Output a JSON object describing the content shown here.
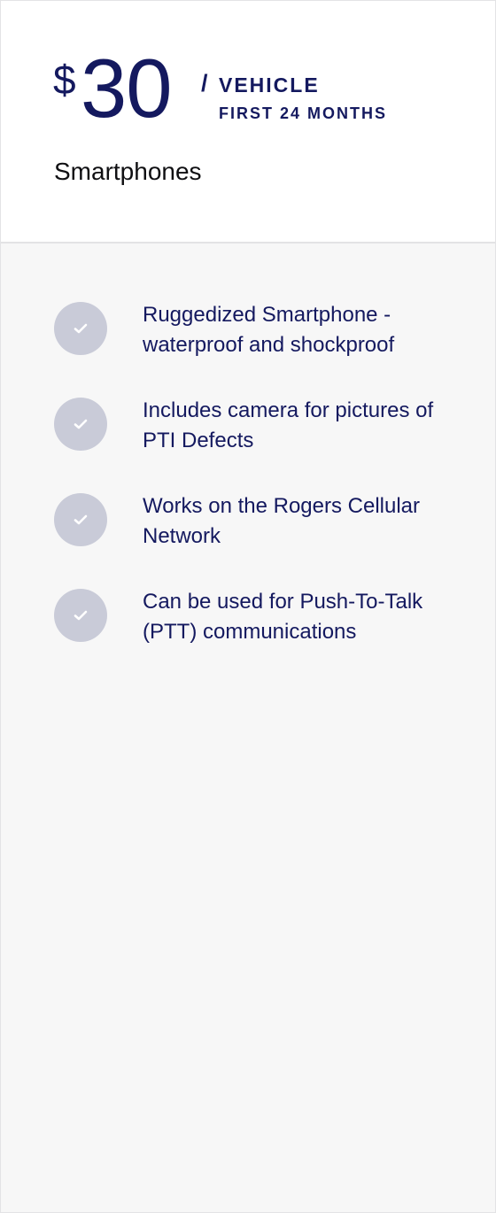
{
  "pricing": {
    "currency": "$",
    "amount": "30",
    "slash": "/",
    "unit": "VEHICLE",
    "period": "FIRST 24 MONTHS",
    "plan_name": "Smartphones"
  },
  "features": [
    {
      "text": "Ruggedized Smartphone - waterproof and shockproof",
      "icon": "check-icon"
    },
    {
      "text": "Includes camera for pictures of PTI Defects",
      "icon": "check-icon"
    },
    {
      "text": "Works on the Rogers Cellular Network",
      "icon": "check-icon"
    },
    {
      "text": "Can be used for Push-To-Talk (PTT) communications",
      "icon": "check-icon"
    }
  ],
  "colors": {
    "accent": "#14195f",
    "check_circle": "#c9cbd8",
    "panel_bg": "#f7f7f7"
  }
}
